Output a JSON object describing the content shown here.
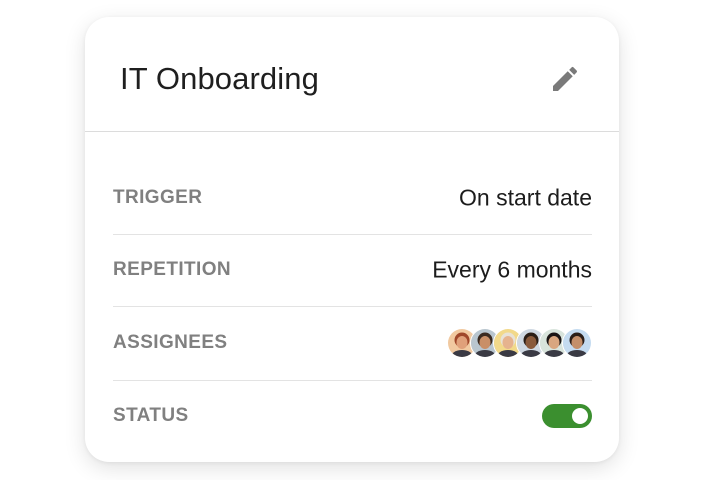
{
  "card": {
    "title": "IT Onboarding"
  },
  "icons": {
    "edit": "pencil-icon",
    "accent_color": "#3b8f2f"
  },
  "rows": {
    "trigger": {
      "label": "TRIGGER",
      "value": "On start date"
    },
    "repetition": {
      "label": "REPETITION",
      "value": "Every 6 months"
    },
    "assignees": {
      "label": "ASSIGNEES",
      "avatars": [
        {
          "bg": "#f1c9a0",
          "skin": "#e0a07a",
          "hair": "#a0472a"
        },
        {
          "bg": "#b9c6cf",
          "skin": "#c98f67",
          "hair": "#3a2a20"
        },
        {
          "bg": "#f2d98a",
          "skin": "#e6b38e",
          "hair": "#e8e2d6"
        },
        {
          "bg": "#cfd8e2",
          "skin": "#8a5a3c",
          "hair": "#2a1d16"
        },
        {
          "bg": "#d8e4dc",
          "skin": "#d9a67f",
          "hair": "#1a1414"
        },
        {
          "bg": "#c4dbf0",
          "skin": "#c48f6a",
          "hair": "#2b1e18"
        }
      ]
    },
    "status": {
      "label": "STATUS",
      "enabled": true
    }
  }
}
